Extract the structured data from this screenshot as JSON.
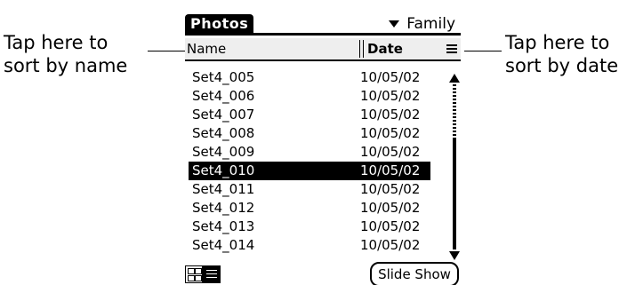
{
  "callouts": {
    "left": "Tap here to sort by name",
    "right": "Tap here to sort by date"
  },
  "app": {
    "title": "Photos",
    "category": "Family"
  },
  "columns": {
    "name": "Name",
    "date": "Date"
  },
  "rows": [
    {
      "name": "Set4_005",
      "date": "10/05/02",
      "selected": false
    },
    {
      "name": "Set4_006",
      "date": "10/05/02",
      "selected": false
    },
    {
      "name": "Set4_007",
      "date": "10/05/02",
      "selected": false
    },
    {
      "name": "Set4_008",
      "date": "10/05/02",
      "selected": false
    },
    {
      "name": "Set4_009",
      "date": "10/05/02",
      "selected": false
    },
    {
      "name": "Set4_010",
      "date": "10/05/02",
      "selected": true
    },
    {
      "name": "Set4_011",
      "date": "10/05/02",
      "selected": false
    },
    {
      "name": "Set4_012",
      "date": "10/05/02",
      "selected": false
    },
    {
      "name": "Set4_013",
      "date": "10/05/02",
      "selected": false
    },
    {
      "name": "Set4_014",
      "date": "10/05/02",
      "selected": false
    }
  ],
  "buttons": {
    "slide_show": "Slide Show"
  },
  "icons": {
    "category_dropdown": "triangle-down-icon",
    "sort": "sort-lines-icon",
    "thumbnail_view": "thumbnail-grid-icon",
    "list_view": "list-view-icon"
  }
}
